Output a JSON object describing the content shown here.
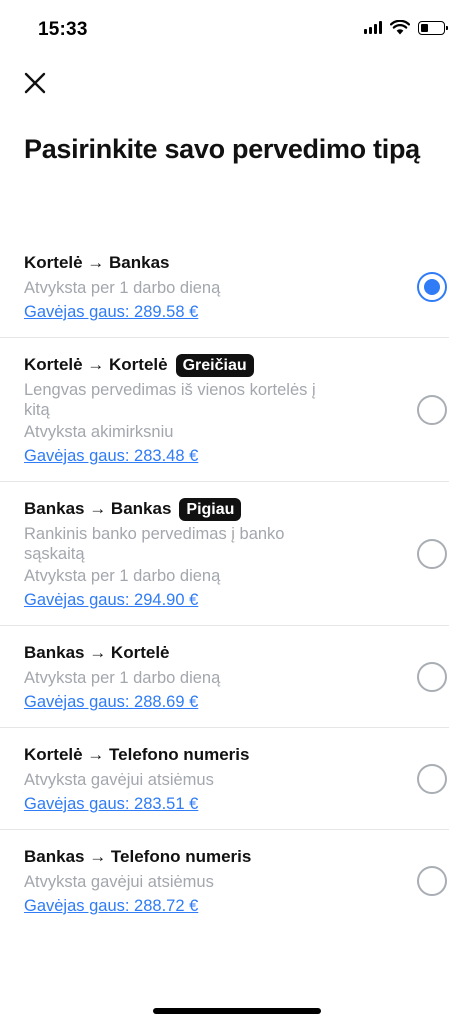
{
  "status_bar": {
    "time": "15:33",
    "icons": [
      "signal-icon",
      "wifi-icon",
      "battery-icon"
    ],
    "battery_level": 0.35
  },
  "header": {
    "close_icon": "close-icon",
    "title": "Pasirinkite savo pervedimo tipą"
  },
  "options": [
    {
      "title": "Kortelė → Bankas",
      "badge": "",
      "description": [
        "Atvyksta per 1 darbo dieną"
      ],
      "receive": "Gavėjas gaus: 289.58 €",
      "selected": true
    },
    {
      "title": "Kortelė → Kortelė",
      "badge": "Greičiau",
      "description": [
        "Lengvas pervedimas iš vienos kortelės į kitą",
        "Atvyksta akimirksniu"
      ],
      "receive": "Gavėjas gaus: 283.48 €",
      "selected": false
    },
    {
      "title": "Bankas → Bankas",
      "badge": "Pigiau",
      "description": [
        "Rankinis banko pervedimas į banko sąskaitą",
        "Atvyksta per 1 darbo dieną"
      ],
      "receive": "Gavėjas gaus: 294.90 €",
      "selected": false
    },
    {
      "title": "Bankas → Kortelė",
      "badge": "",
      "description": [
        "Atvyksta per 1 darbo dieną"
      ],
      "receive": "Gavėjas gaus: 288.69 €",
      "selected": false
    },
    {
      "title": "Kortelė → Telefono numeris",
      "badge": "",
      "description": [
        "Atvyksta gavėjui atsiėmus"
      ],
      "receive": "Gavėjas gaus: 283.51 €",
      "selected": false
    },
    {
      "title": "Bankas → Telefono numeris",
      "badge": "",
      "description": [
        "Atvyksta gavėjui atsiėmus"
      ],
      "receive": "Gavėjas gaus: 288.72 €",
      "selected": false
    }
  ],
  "colors": {
    "accent": "#2f7cf6",
    "muted_text": "#a3a7ad",
    "badge_bg": "#111111",
    "radio_border": "#a9adb4"
  }
}
